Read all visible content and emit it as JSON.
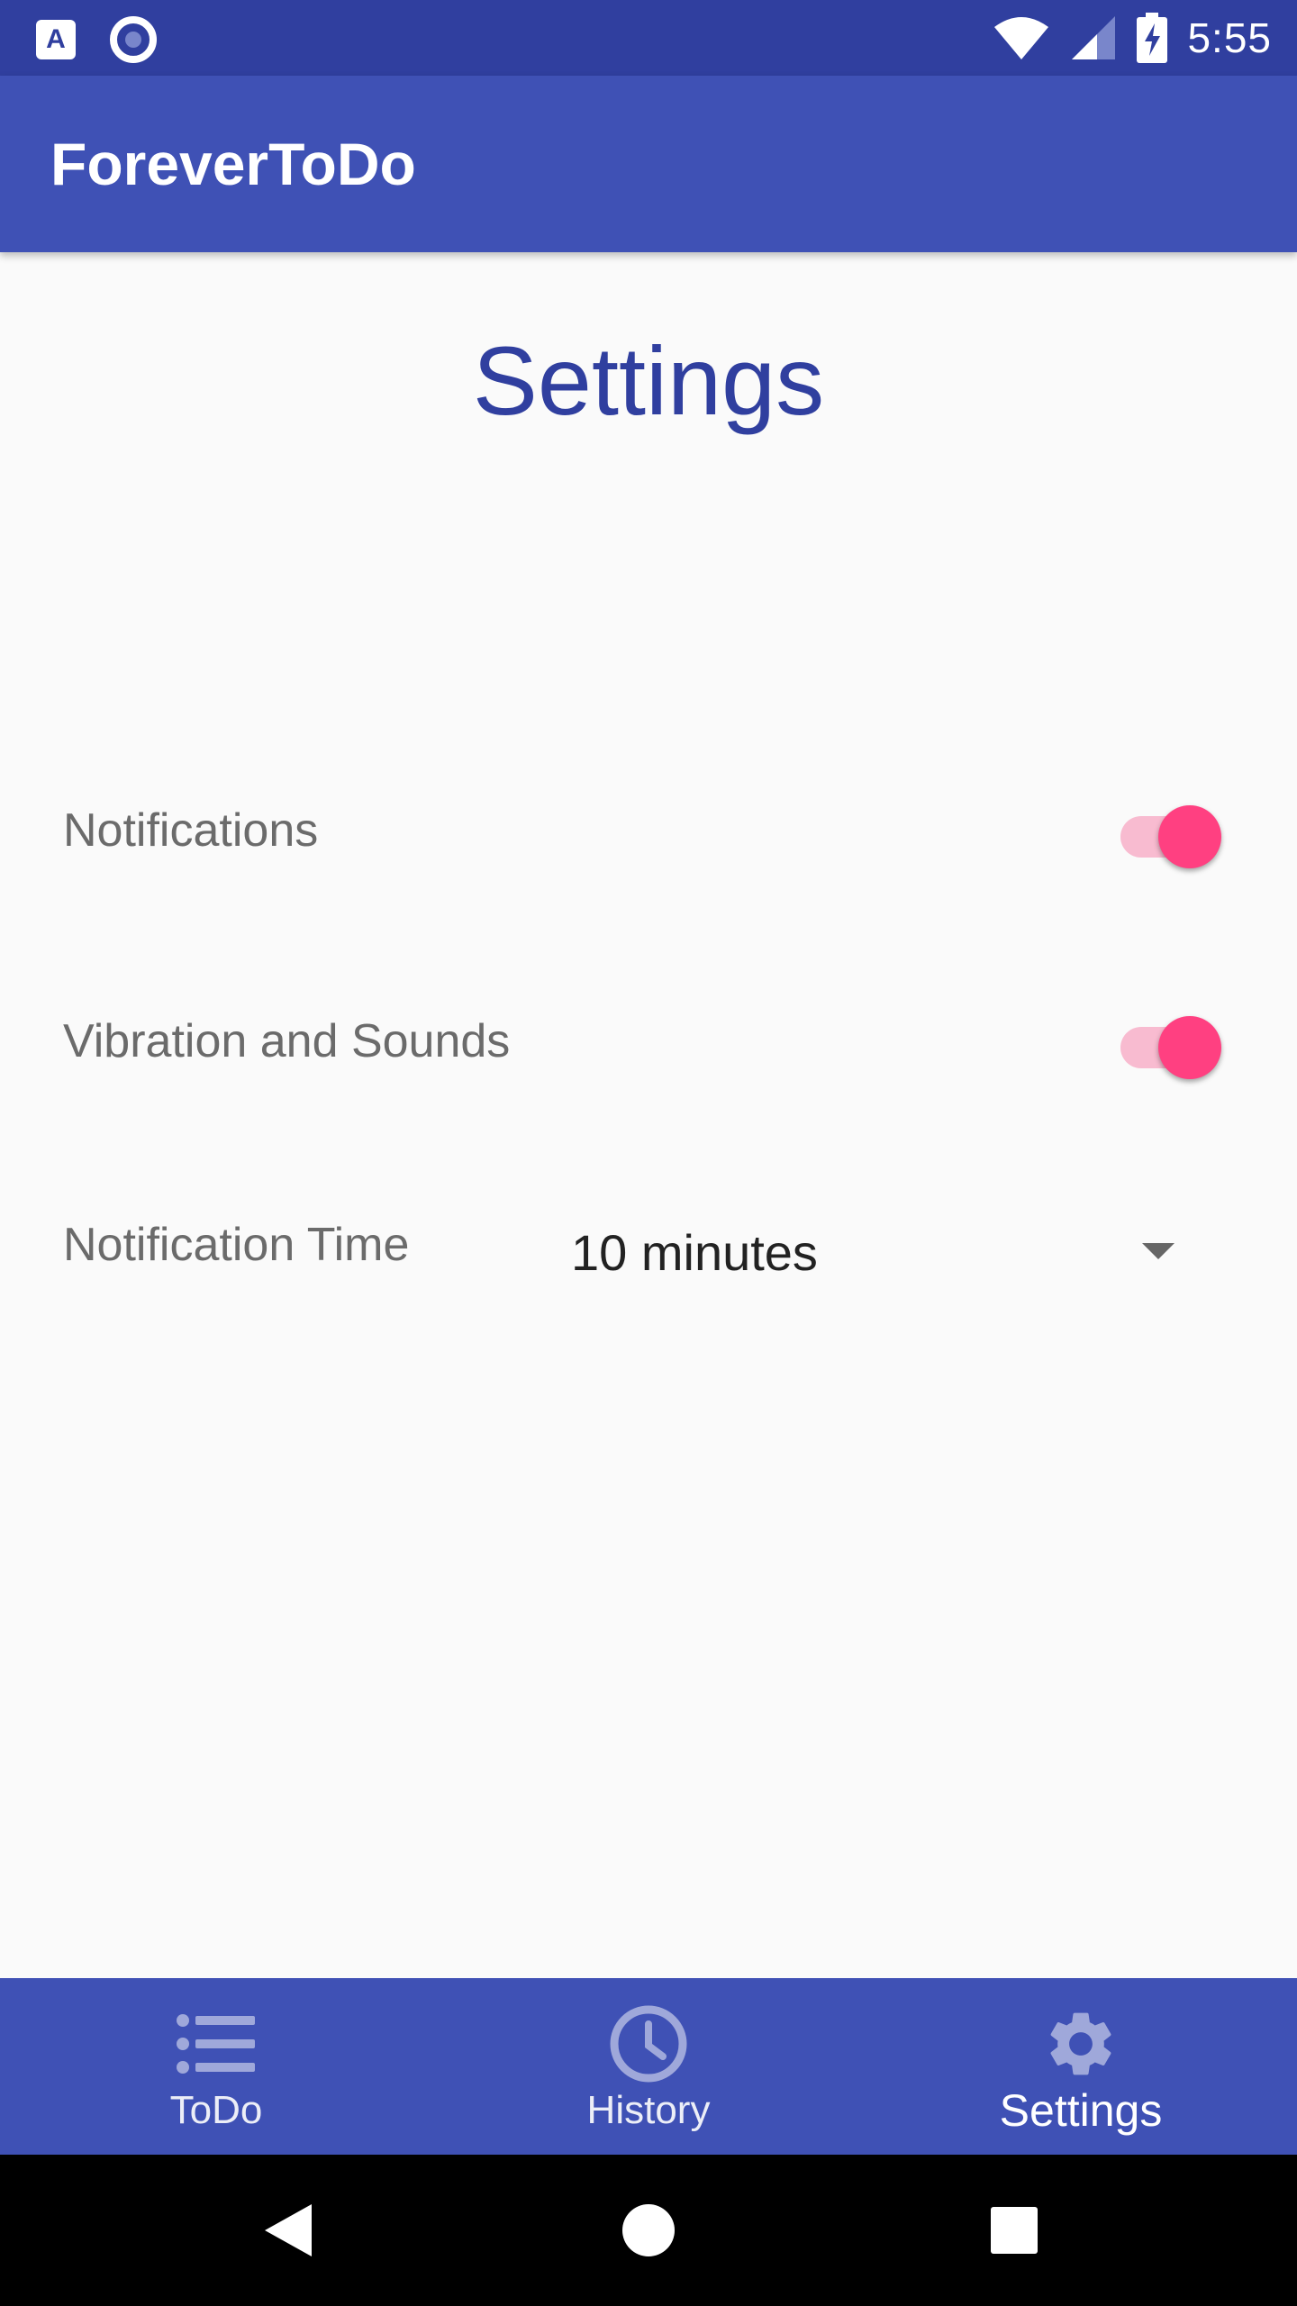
{
  "status_bar": {
    "left_icons": [
      "a-keyboard-icon",
      "circle-record-icon"
    ],
    "right_icons": [
      "wifi-icon",
      "cell-signal-icon",
      "battery-charging-icon"
    ],
    "time": "5:55",
    "color": "#303F9F"
  },
  "app_bar": {
    "title": "ForeverToDo",
    "color": "#3F51B5"
  },
  "page": {
    "heading": "Settings",
    "heading_color": "#303F9F"
  },
  "settings": {
    "notifications": {
      "label": "Notifications",
      "enabled": true
    },
    "vibration_sounds": {
      "label": "Vibration and Sounds",
      "enabled": true
    },
    "notification_time": {
      "label": "Notification Time",
      "selected": "10 minutes"
    },
    "accent_color": "#FF4081"
  },
  "bottom_nav": {
    "items": [
      {
        "label": "ToDo",
        "icon": "list-icon",
        "active": false
      },
      {
        "label": "History",
        "icon": "clock-icon",
        "active": false
      },
      {
        "label": "Settings",
        "icon": "gear-icon",
        "active": true
      }
    ]
  },
  "system_nav": {
    "buttons": [
      "back-icon",
      "home-icon",
      "recents-icon"
    ]
  }
}
